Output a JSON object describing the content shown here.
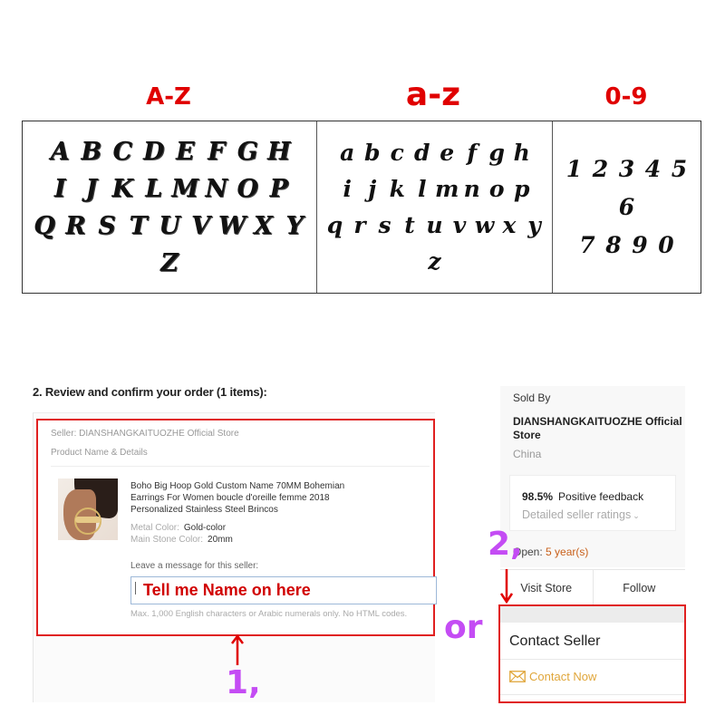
{
  "font_chart": {
    "titles": {
      "uppercase": "A-Z",
      "lowercase": "a-z",
      "digits": "0-9"
    },
    "uppercase_rows": [
      [
        "A",
        "B",
        "C",
        "D",
        "E",
        "F",
        "G",
        "H"
      ],
      [
        "I",
        "J",
        "K",
        "L",
        "M",
        "N",
        "O",
        "P"
      ],
      [
        "Q",
        "R",
        "S",
        "T",
        "U",
        "V",
        "W",
        "X",
        "Y"
      ],
      [
        "Z"
      ]
    ],
    "lowercase_rows": [
      [
        "a",
        "b",
        "c",
        "d",
        "e",
        "f",
        "g",
        "h"
      ],
      [
        "i",
        "j",
        "k",
        "l",
        "m",
        "n",
        "o",
        "p"
      ],
      [
        "q",
        "r",
        "s",
        "t",
        "u",
        "v",
        "w",
        "x",
        "y"
      ],
      [
        "z"
      ]
    ],
    "digit_rows": [
      [
        "1",
        "2",
        "3",
        "4",
        "5"
      ],
      [
        "6"
      ],
      [
        "7",
        "8",
        "9",
        "0"
      ]
    ]
  },
  "order": {
    "heading": "2. Review and confirm your order (1 items):",
    "seller_line": "Seller: DIANSHANGKAITUOZHE Official Store",
    "product_label": "Product Name & Details",
    "product_title": "Boho Big Hoop Gold Custom Name 70MM Bohemian Earrings For Women boucle d'oreille femme 2018 Personalized Stainless Steel Brincos",
    "attributes": [
      {
        "key": "Metal Color:",
        "value": "Gold-color"
      },
      {
        "key": "Main Stone Color:",
        "value": "20mm"
      }
    ],
    "message_label": "Leave a message for this seller:",
    "message_value": "Tell me Name on here",
    "message_hint": "Max. 1,000 English characters or Arabic numerals only. No HTML codes."
  },
  "seller": {
    "sold_by_label": "Sold By",
    "store_name": "DIANSHANGKAITUOZHE Official Store",
    "country": "China",
    "feedback_percent": "98.5%",
    "feedback_label": "Positive feedback",
    "detailed_ratings": "Detailed seller ratings",
    "open_label": "Open:",
    "open_value": "5 year(s)",
    "visit_store": "Visit Store",
    "follow": "Follow",
    "contact_title": "Contact Seller",
    "contact_now": "Contact Now"
  },
  "annotations": {
    "step1": "1,",
    "step2": "2,",
    "or": "or"
  },
  "colors": {
    "title_red": "#e00000",
    "highlight_box": "#e02020",
    "annotation_purple": "#c44cf4",
    "contact_link": "#e0a63a",
    "open_years": "#c8601a"
  }
}
